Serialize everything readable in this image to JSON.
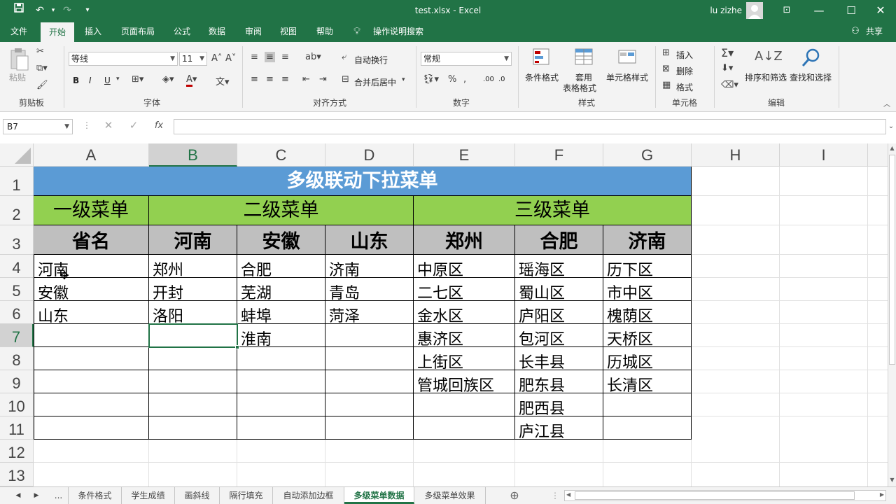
{
  "window": {
    "title": "test.xlsx  -  Excel",
    "user": "lu zizhe"
  },
  "menu": {
    "tabs": [
      "文件",
      "开始",
      "插入",
      "页面布局",
      "公式",
      "数据",
      "审阅",
      "视图",
      "帮助"
    ],
    "active_tab": "开始",
    "tell_me": "操作说明搜索",
    "share": "共享"
  },
  "ribbon": {
    "clipboard": {
      "label": "剪贴板",
      "paste": "粘贴"
    },
    "font": {
      "label": "字体",
      "name": "等线",
      "size": "11",
      "bold": "B",
      "italic": "I",
      "underline": "U"
    },
    "alignment": {
      "label": "对齐方式",
      "wrap": "自动换行",
      "merge": "合并后居中"
    },
    "number": {
      "label": "数字",
      "format": "常规"
    },
    "styles": {
      "label": "样式",
      "cond_format": "条件格式",
      "table_format_1": "套用",
      "table_format_2": "表格格式",
      "cell_styles": "单元格样式"
    },
    "cells": {
      "label": "单元格",
      "insert": "插入",
      "delete": "删除",
      "format": "格式"
    },
    "editing": {
      "label": "编辑",
      "sort": "排序和筛选",
      "find": "查找和选择"
    }
  },
  "formula_bar": {
    "name_box": "B7",
    "fx": "fx",
    "value": ""
  },
  "columns": [
    "A",
    "B",
    "C",
    "D",
    "E",
    "F",
    "G",
    "H",
    "I"
  ],
  "selected_column": "B",
  "rows": [
    "1",
    "2",
    "3",
    "4",
    "5",
    "6",
    "7",
    "8",
    "9",
    "10",
    "11",
    "12",
    "13"
  ],
  "selected_row": "7",
  "sheet": {
    "title": "多级联动下拉菜单",
    "level1": "一级菜单",
    "level2": "二级菜单",
    "level3": "三级菜单",
    "headers": [
      "省名",
      "河南",
      "安徽",
      "山东",
      "郑州",
      "合肥",
      "济南"
    ],
    "col_a": [
      "河南",
      "安徽",
      "山东"
    ],
    "col_b": [
      "郑州",
      "开封",
      "洛阳"
    ],
    "col_c": [
      "合肥",
      "芜湖",
      "蚌埠",
      "淮南"
    ],
    "col_d": [
      "济南",
      "青岛",
      "菏泽"
    ],
    "col_e": [
      "中原区",
      "二七区",
      "金水区",
      "惠济区",
      "上街区",
      "管城回族区"
    ],
    "col_f": [
      "瑶海区",
      "蜀山区",
      "庐阳区",
      "包河区",
      "长丰县",
      "肥东县",
      "肥西县",
      "庐江县"
    ],
    "col_g": [
      "历下区",
      "市中区",
      "槐荫区",
      "天桥区",
      "历城区",
      "长清区"
    ]
  },
  "colors": {
    "title_bg": "#5b9bd5",
    "level_bg": "#92d050",
    "header_bg": "#bfbfbf",
    "excel_green": "#217346"
  },
  "sheet_tabs": {
    "more": "...",
    "tabs": [
      "条件格式",
      "学生成绩",
      "画斜线",
      "隔行填充",
      "自动添加边框",
      "多级菜单数据",
      "多级菜单效果"
    ],
    "active": "多级菜单数据"
  }
}
